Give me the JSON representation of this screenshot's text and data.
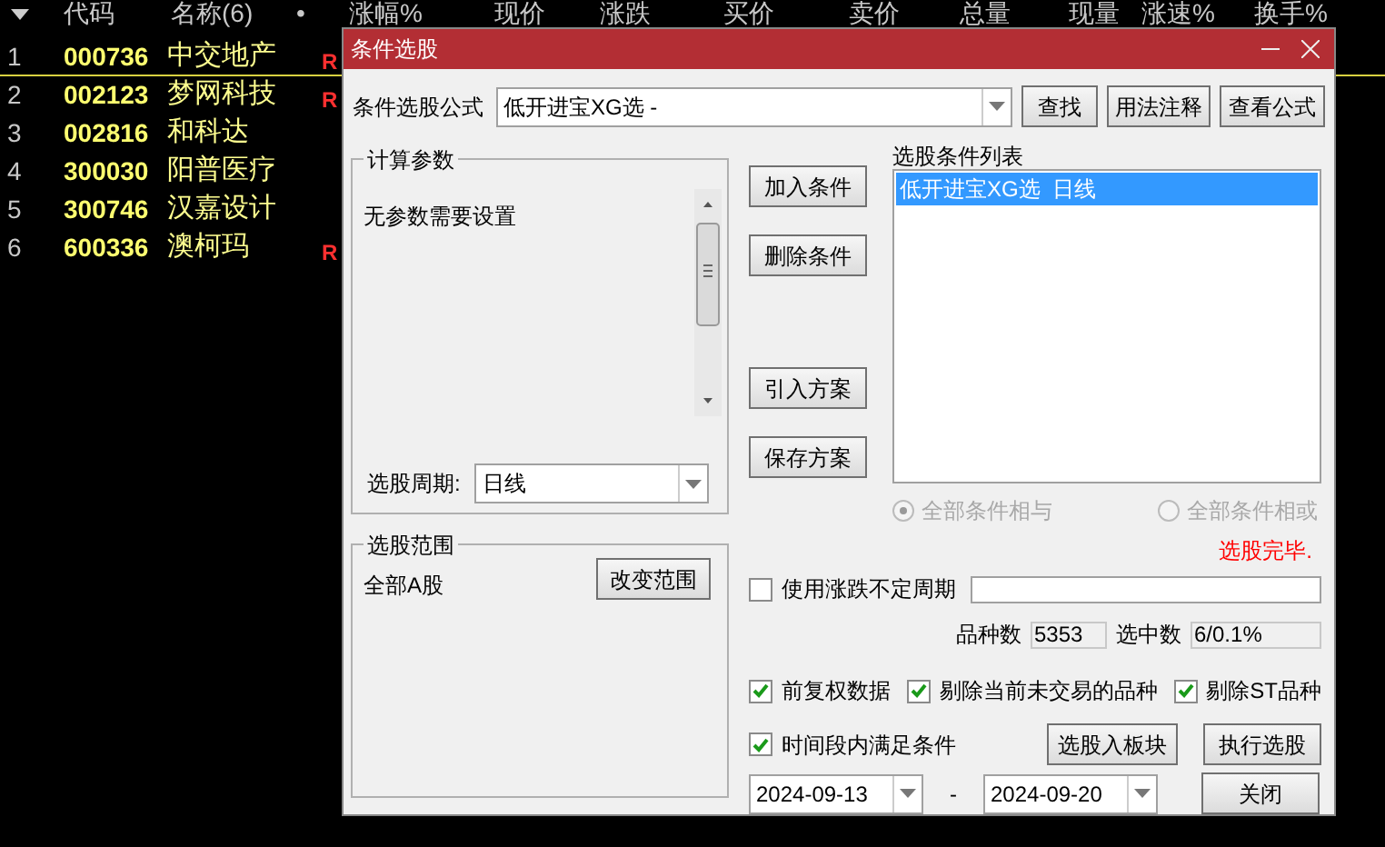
{
  "table": {
    "columns": [
      "代码",
      "名称(6)",
      "•",
      "涨幅%",
      "现价",
      "涨跌",
      "买价",
      "卖价",
      "总量",
      "现量",
      "涨速%",
      "换手%"
    ],
    "rows": [
      {
        "index": "1",
        "code": "000736",
        "name": "中交地产",
        "mark": "R",
        "selected": true
      },
      {
        "index": "2",
        "code": "002123",
        "name": "梦网科技",
        "mark": "R",
        "selected": false
      },
      {
        "index": "3",
        "code": "002816",
        "name": "和科达",
        "selected": false
      },
      {
        "index": "4",
        "code": "300030",
        "name": "阳普医疗",
        "selected": false
      },
      {
        "index": "5",
        "code": "300746",
        "name": "汉嘉设计",
        "selected": false
      },
      {
        "index": "6",
        "code": "600336",
        "name": "澳柯玛",
        "mark": "R",
        "selected": false
      }
    ]
  },
  "dialog": {
    "title": "条件选股",
    "formula": {
      "label": "条件选股公式",
      "value": "低开进宝XG选 -"
    },
    "formula_buttons": [
      "查找",
      "用法注释",
      "查看公式"
    ],
    "params": {
      "title": "计算参数",
      "text": "无参数需要设置",
      "period_label": "选股周期:",
      "period_value": "日线"
    },
    "action_buttons": [
      "加入条件",
      "删除条件",
      "引入方案",
      "保存方案"
    ],
    "condition_list": {
      "label": "选股条件列表",
      "items": [
        {
          "text": "低开进宝XG选  日线",
          "selected": true
        }
      ]
    },
    "logic": [
      {
        "label": "全部条件相与",
        "selected": true
      },
      {
        "label": "全部条件相或",
        "selected": false
      }
    ],
    "status": "选股完毕.",
    "range": {
      "title": "选股范围",
      "value": "全部Α股",
      "button": "改变范围"
    },
    "variable_period": {
      "label": "使用涨跌不定周期",
      "checked": false
    },
    "counts": [
      {
        "label": "品种数",
        "value": "5353"
      },
      {
        "label": "选中数",
        "value": "6/0.1%"
      }
    ],
    "options": [
      {
        "label": "前复权数据",
        "checked": true
      },
      {
        "label": "剔除当前未交易的品种",
        "checked": true
      },
      {
        "label": "剔除ST品种",
        "checked": true
      }
    ],
    "time_range": {
      "label": "时间段内满足条件",
      "checked": true,
      "start": "2024-09-13",
      "separator": "-",
      "end": "2024-09-20"
    },
    "buttons": [
      "选股入板块",
      "执行选股",
      "关闭"
    ]
  }
}
